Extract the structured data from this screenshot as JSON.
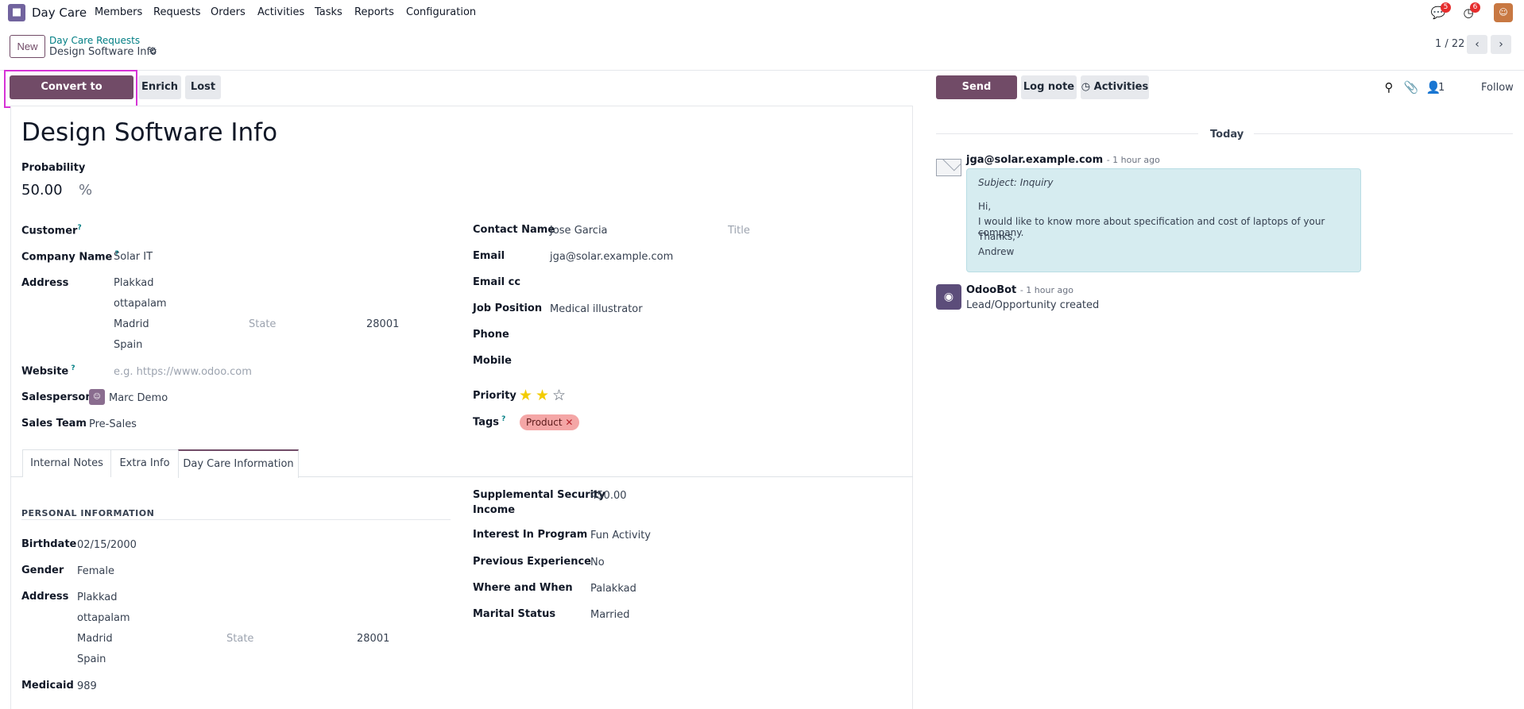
{
  "nav": {
    "app_name": "Day Care",
    "menu": [
      "Members",
      "Requests",
      "Orders",
      "Activities",
      "Tasks",
      "Reports",
      "Configuration"
    ],
    "messages_count": "5",
    "activities_count": "6"
  },
  "control": {
    "new_label": "New",
    "breadcrumb_parent": "Day Care Requests",
    "breadcrumb_current": "Design Software Info",
    "pager": "1 / 22"
  },
  "statusbar": {
    "convert": "Convert to Opportunity",
    "enrich": "Enrich",
    "lost": "Lost"
  },
  "form": {
    "title": "Design Software Info",
    "probability_label": "Probability",
    "probability": "50.00",
    "probability_unit": "%",
    "customer_label": "Customer",
    "company_label": "Company Name",
    "company": "Solar IT",
    "address_label": "Address",
    "street": "Plakkad",
    "street2": "ottapalam",
    "city": "Madrid",
    "state_ph": "State",
    "zip": "28001",
    "country": "Spain",
    "website_label": "Website",
    "website_ph": "e.g. https://www.odoo.com",
    "salesperson_label": "Salesperson",
    "salesperson": "Marc Demo",
    "team_label": "Sales Team",
    "team": "Pre-Sales",
    "contact_label": "Contact Name",
    "contact": "Jose Garcia",
    "title_ph": "Title",
    "email_label": "Email",
    "email": "jga@solar.example.com",
    "emailcc_label": "Email cc",
    "job_label": "Job Position",
    "job": "Medical illustrator",
    "phone_label": "Phone",
    "mobile_label": "Mobile",
    "priority_label": "Priority",
    "priority": 2,
    "priority_max": 3,
    "tags_label": "Tags",
    "tag": "Product"
  },
  "tabs": [
    "Internal Notes",
    "Extra Info",
    "Day Care Information"
  ],
  "daycare": {
    "section": "PERSONAL INFORMATION",
    "birthdate_label": "Birthdate",
    "birthdate": "02/15/2000",
    "gender_label": "Gender",
    "gender": "Female",
    "address_label": "Address",
    "street": "Plakkad",
    "street2": "ottapalam",
    "city": "Madrid",
    "state_ph": "State",
    "zip": "28001",
    "country": "Spain",
    "medicaid_label": "Medicaid",
    "medicaid": "989",
    "ssi_label1": "Supplemental Security",
    "ssi_label2": "Income",
    "ssi": "450.00",
    "interest_label": "Interest In Program",
    "interest": "Fun Activity",
    "prev_label": "Previous Experience",
    "prev": "No",
    "where_label": "Where and When",
    "where": "Palakkad",
    "marital_label": "Marital Status",
    "marital": "Married"
  },
  "chatter": {
    "send_message": "Send message",
    "log_note": "Log note",
    "activities": "Activities",
    "followers": "1",
    "follow": "Follow",
    "day": "Today",
    "messages": [
      {
        "author": "jga@solar.example.com",
        "time": "- 1 hour ago",
        "subject": "Subject: Inquiry",
        "lines": [
          "Hi,",
          "I would like to know more about specification and cost of laptops of your company.",
          "Thanks,",
          "Andrew"
        ]
      },
      {
        "author": "OdooBot",
        "time": "- 1 hour ago",
        "body": "Lead/Opportunity created"
      }
    ]
  }
}
